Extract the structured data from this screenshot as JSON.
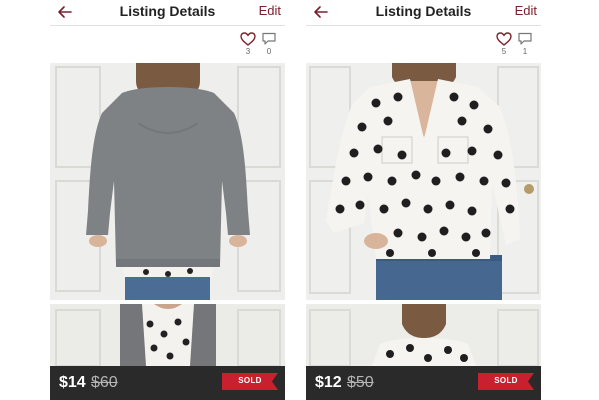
{
  "colors": {
    "accent": "#7a1f2b",
    "price_bar": "#2a2a2a",
    "sold_badge": "#c8202e"
  },
  "listings": [
    {
      "header": {
        "title": "Listing Details",
        "edit_label": "Edit",
        "back_icon": "arrow-left-icon"
      },
      "stats": {
        "likes": "3",
        "comments": "0"
      },
      "price": {
        "current": "$14",
        "original": "$60"
      },
      "status": "SOLD"
    },
    {
      "header": {
        "title": "Listing Details",
        "edit_label": "Edit",
        "back_icon": "arrow-left-icon"
      },
      "stats": {
        "likes": "5",
        "comments": "1"
      },
      "price": {
        "current": "$12",
        "original": "$50"
      },
      "status": "SOLD"
    }
  ]
}
